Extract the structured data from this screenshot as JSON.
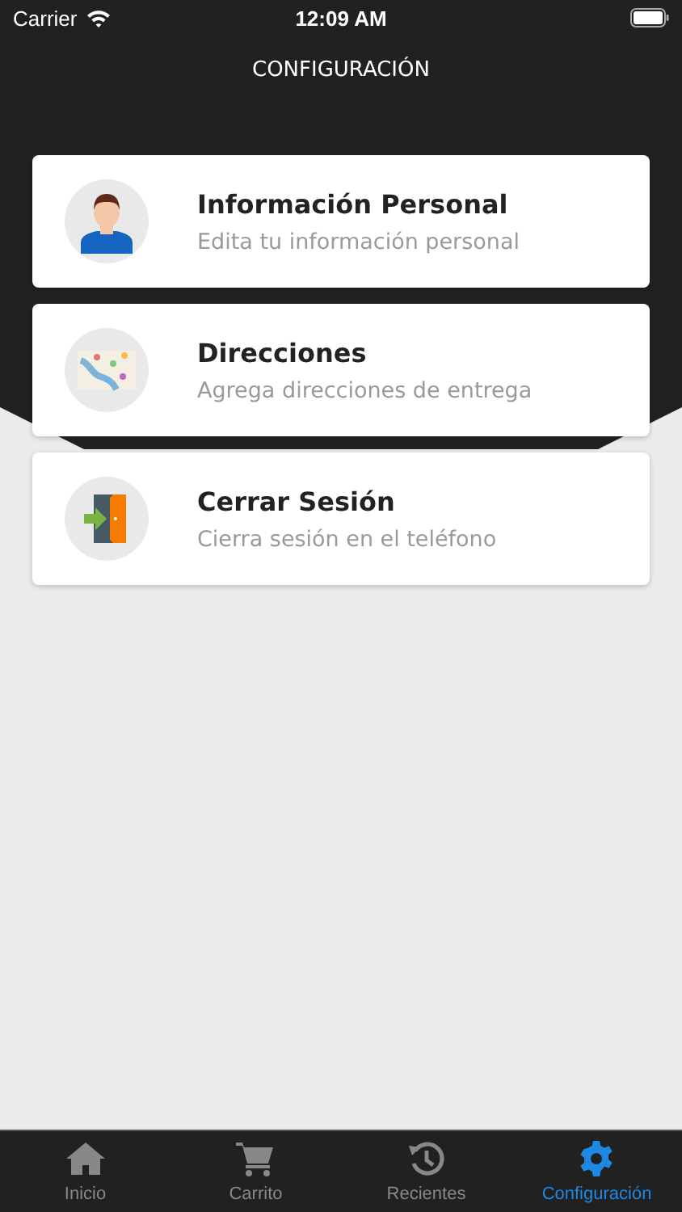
{
  "status_bar": {
    "carrier": "Carrier",
    "time": "12:09 AM"
  },
  "title": "CONFIGURACIÓN",
  "items": [
    {
      "kind": "person",
      "title": "Información Personal",
      "subtitle": "Edita tu información personal"
    },
    {
      "kind": "map",
      "title": "Direcciones",
      "subtitle": "Agrega direcciones de entrega"
    },
    {
      "kind": "logout",
      "title": "Cerrar Sesión",
      "subtitle": "Cierra sesión en el teléfono"
    }
  ],
  "tabs": [
    {
      "kind": "home",
      "label": "Inicio",
      "selected": false
    },
    {
      "kind": "cart",
      "label": "Carrito",
      "selected": false
    },
    {
      "kind": "history",
      "label": "Recientes",
      "selected": false
    },
    {
      "kind": "gear",
      "label": "Configuración",
      "selected": true
    }
  ]
}
